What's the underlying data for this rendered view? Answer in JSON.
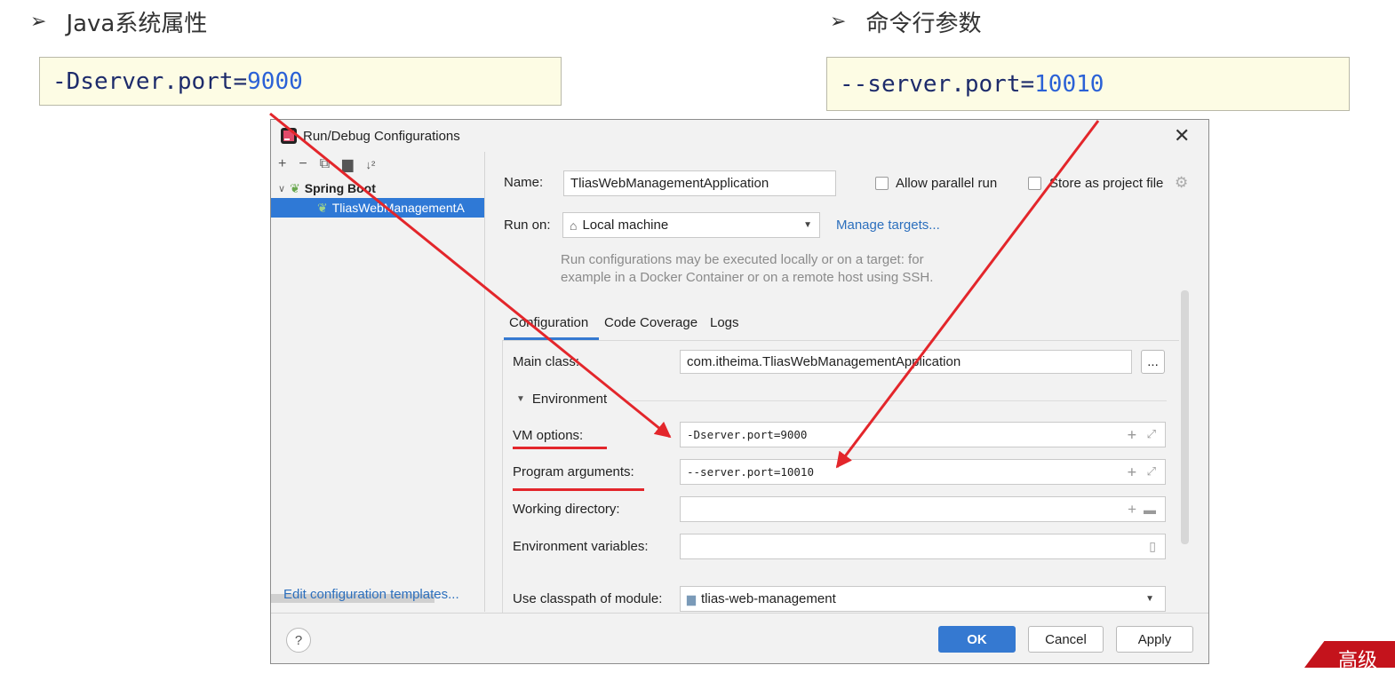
{
  "slide": {
    "left_heading": "Java系统属性",
    "right_heading": "命令行参数",
    "bullet": "➢",
    "left_code_prefix": "-Dserver.port=",
    "left_code_value": "9000",
    "right_code_prefix": "--server.port=",
    "right_code_value": "10010",
    "corner_badge": "高级"
  },
  "dialog": {
    "title": "Run/Debug Configurations",
    "tree": {
      "group": "Spring Boot",
      "item": "TliasWebManagementA"
    },
    "edit_templates_link": "Edit configuration templates...",
    "name_label": "Name:",
    "name_value": "TliasWebManagementApplication",
    "allow_parallel_label": "Allow parallel run",
    "store_project_label": "Store as project file",
    "run_on_label": "Run on:",
    "run_on_value": "Local machine",
    "manage_targets_link": "Manage targets...",
    "run_on_hint_1": "Run configurations may be executed locally or on a target: for",
    "run_on_hint_2": "example in a Docker Container or on a remote host using SSH.",
    "tabs": [
      "Configuration",
      "Code Coverage",
      "Logs"
    ],
    "main_class_label": "Main class:",
    "main_class_value": "com.itheima.TliasWebManagementApplication",
    "browse_button": "...",
    "environment_label": "Environment",
    "vm_options_label": "VM options:",
    "vm_options_value": "-Dserver.port=9000",
    "program_args_label": "Program arguments:",
    "program_args_value": "--server.port=10010",
    "working_dir_label": "Working directory:",
    "env_vars_label": "Environment variables:",
    "classpath_label": "Use classpath of module:",
    "classpath_value": "tlias-web-management",
    "help_button": "?",
    "ok_button": "OK",
    "cancel_button": "Cancel",
    "apply_button": "Apply"
  },
  "colors": {
    "accent": "#2f79d6",
    "annotation_red": "#e3262b",
    "code_box_bg": "#fdfce4"
  }
}
